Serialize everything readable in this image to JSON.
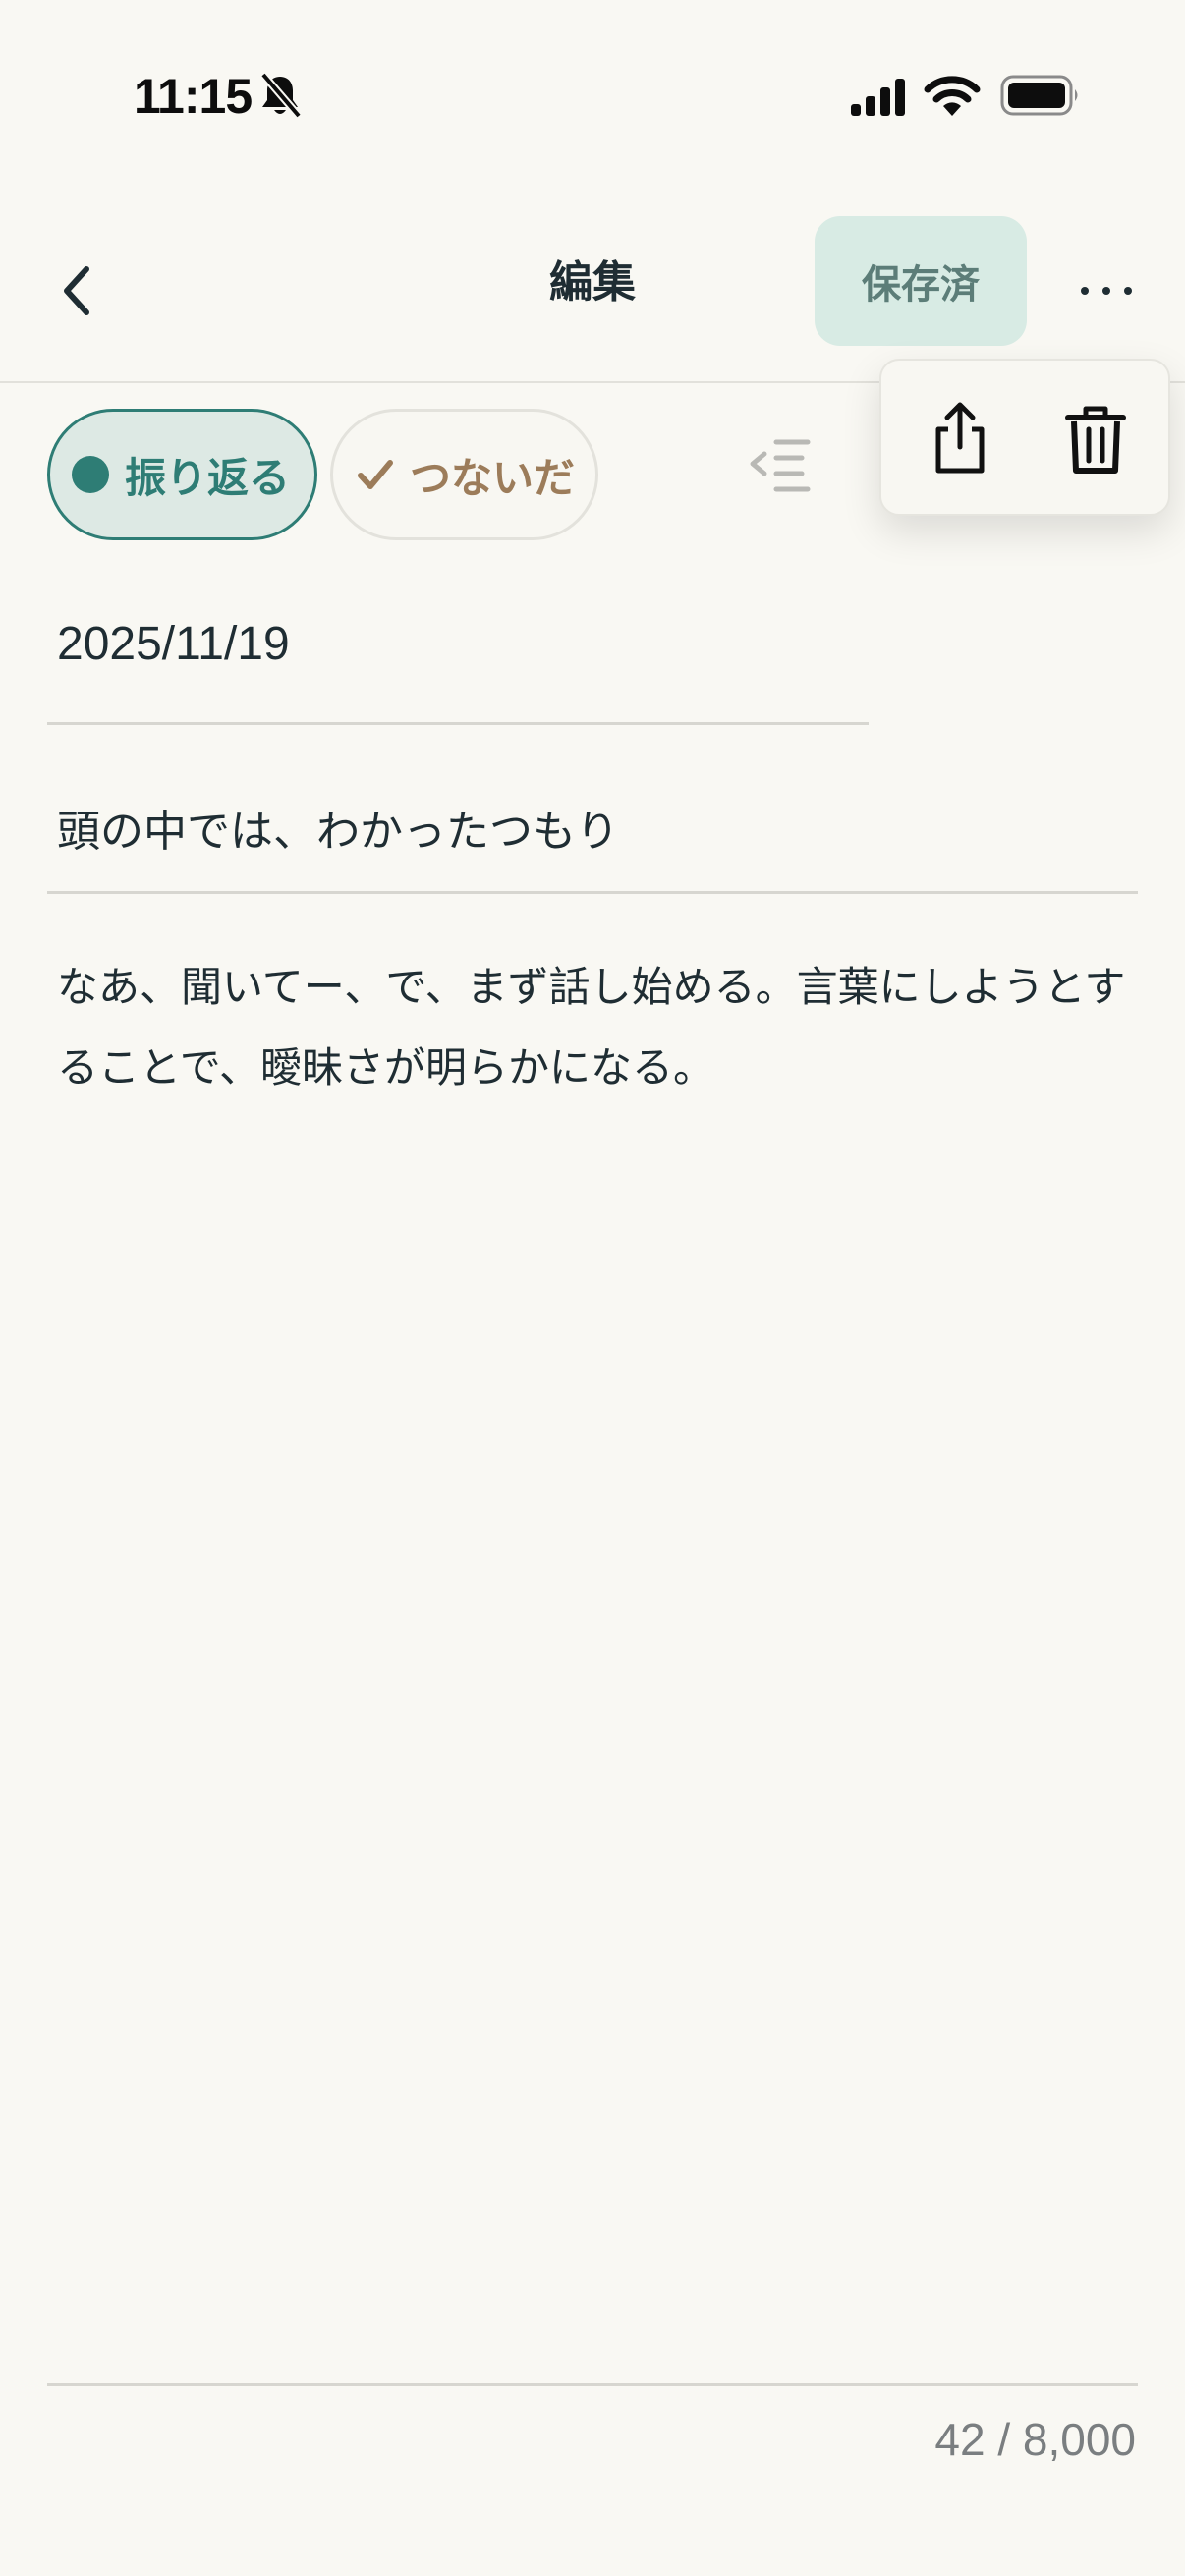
{
  "status_bar": {
    "time": "11:15",
    "icons": [
      "bell-slash-icon",
      "cellular-signal-icon",
      "wifi-icon",
      "battery-icon"
    ]
  },
  "nav": {
    "back_icon": "chevron-left-icon",
    "title": "編集",
    "saved_label": "保存済",
    "more_icon": "ellipsis-icon"
  },
  "menu": {
    "items": [
      {
        "icon": "share-icon"
      },
      {
        "icon": "trash-icon"
      }
    ]
  },
  "chips": {
    "reflect_label": "振り返る",
    "connected_label": "つないだ",
    "outline_icon": "outline-collapse-icon"
  },
  "entry": {
    "date": "2025/11/19",
    "title": "頭の中では、わかったつもり",
    "body": "なあ、聞いてー、で、まず話し始める。言葉にしようとすることで、曖昧さが明らかになる。"
  },
  "footer": {
    "char_count": "42 / 8,000"
  },
  "colors": {
    "background": "#f9f8f3",
    "accent_teal": "#2e7d75",
    "saved_bg": "#d8ebe4",
    "connected_brown": "#9c7c5a",
    "text_dark": "#1f2d33"
  }
}
